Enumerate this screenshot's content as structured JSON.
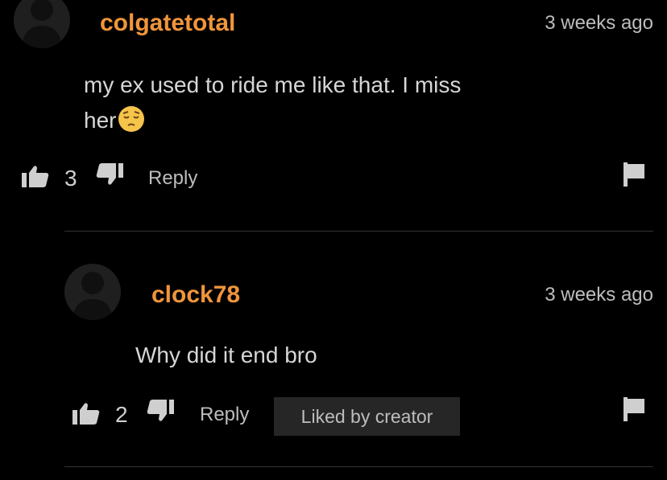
{
  "comments": [
    {
      "username": "colgatetotal",
      "time": "3 weeks ago",
      "text_line1": "my ex used to ride me like that. I miss",
      "text_line2": "her",
      "emoji": "pensive-face",
      "likes": "3",
      "reply_label": "Reply"
    },
    {
      "username": "clock78",
      "time": "3 weeks ago",
      "text": "Why did it end bro",
      "likes": "2",
      "reply_label": "Reply",
      "badge": "Liked by creator"
    }
  ],
  "colors": {
    "username": "#f0953a",
    "background": "#000000",
    "badge_bg": "#262626"
  }
}
